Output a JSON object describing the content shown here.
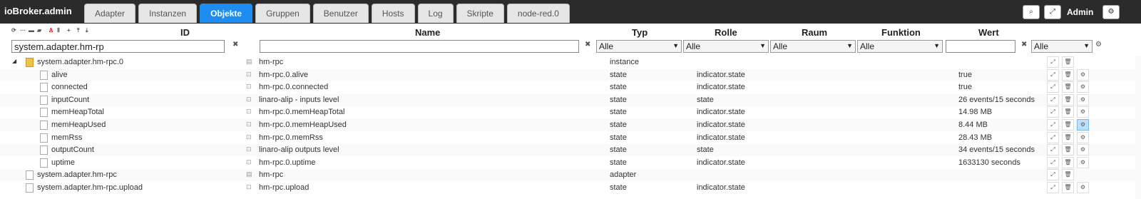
{
  "app": {
    "title": "ioBroker.admin",
    "user": "Admin"
  },
  "tabs": [
    "Adapter",
    "Instanzen",
    "Objekte",
    "Gruppen",
    "Benutzer",
    "Hosts",
    "Log",
    "Skripte",
    "node-red.0"
  ],
  "active_tab": "Objekte",
  "columns": {
    "id": "ID",
    "name": "Name",
    "type": "Typ",
    "role": "Rolle",
    "room": "Raum",
    "function": "Funktion",
    "value": "Wert"
  },
  "filters": {
    "id": "system.adapter.hm-rp",
    "name": "",
    "type": "Alle",
    "role": "Alle",
    "room": "Alle",
    "function": "Alle",
    "value": "",
    "value_select": "Alle"
  },
  "rows": [
    {
      "id": "system.adapter.hm-rpc.0",
      "name": "hm-rpc",
      "type": "instance",
      "role": "",
      "value": "",
      "level": 0,
      "folder": true
    },
    {
      "id": "alive",
      "name": "hm-rpc.0.alive",
      "type": "state",
      "role": "indicator.state",
      "value": "true",
      "level": 1
    },
    {
      "id": "connected",
      "name": "hm-rpc.0.connected",
      "type": "state",
      "role": "indicator.state",
      "value": "true",
      "level": 1
    },
    {
      "id": "inputCount",
      "name": "linaro-alip - inputs level",
      "type": "state",
      "role": "state",
      "value": "26 events/15 seconds",
      "level": 1
    },
    {
      "id": "memHeapTotal",
      "name": "hm-rpc.0.memHeapTotal",
      "type": "state",
      "role": "indicator.state",
      "value": "14.98 MB",
      "level": 1
    },
    {
      "id": "memHeapUsed",
      "name": "hm-rpc.0.memHeapUsed",
      "type": "state",
      "role": "indicator.state",
      "value": "8.44 MB",
      "level": 1,
      "highlight": true
    },
    {
      "id": "memRss",
      "name": "hm-rpc.0.memRss",
      "type": "state",
      "role": "indicator.state",
      "value": "28.43 MB",
      "level": 1
    },
    {
      "id": "outputCount",
      "name": "linaro-alip outputs level",
      "type": "state",
      "role": "state",
      "value": "34 events/15 seconds",
      "level": 1
    },
    {
      "id": "uptime",
      "name": "hm-rpc.0.uptime",
      "type": "state",
      "role": "indicator.state",
      "value": "1633130 seconds",
      "level": 1
    },
    {
      "id": "system.adapter.hm-rpc",
      "name": "hm-rpc",
      "type": "adapter",
      "role": "",
      "value": "",
      "level": 0
    },
    {
      "id": "system.adapter.hm-rpc.upload",
      "name": "hm-rpc.upload",
      "type": "state",
      "role": "indicator.state",
      "value": "",
      "level": 0
    }
  ],
  "colors": {
    "accent": "#1e8df2",
    "topbar": "#2b2b2b"
  }
}
